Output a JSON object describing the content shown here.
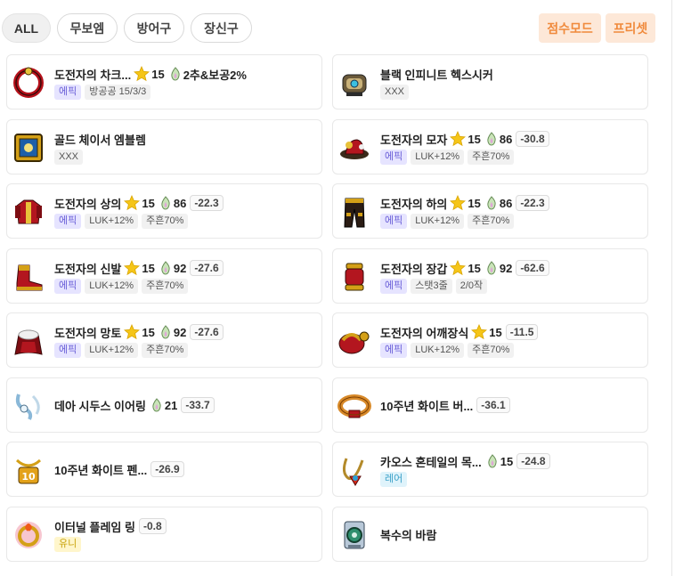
{
  "tabs": [
    {
      "label": "ALL",
      "active": true
    },
    {
      "label": "무보엠",
      "active": false
    },
    {
      "label": "방어구",
      "active": false
    },
    {
      "label": "장신구",
      "active": false
    }
  ],
  "modes": {
    "score_mode": "점수모드",
    "preset": "프리셋"
  },
  "colors": {
    "accent_orange": "#f08a3c",
    "epic": "#6a5fd8",
    "rare": "#3aa0c8",
    "unique": "#c8a20a"
  },
  "items": [
    {
      "name": "도전자의 차크...",
      "icon": "ring-red-icon",
      "star": "15",
      "extra": "2추&보공2%",
      "tags": [
        {
          "text": "에픽",
          "kind": "epic"
        },
        {
          "text": "방공공 15/3/3",
          "kind": "plain"
        }
      ]
    },
    {
      "name": "블랙 인피니트 헥스시커",
      "icon": "hexseeker-icon",
      "tags": [
        {
          "text": "XXX",
          "kind": "plain"
        }
      ]
    },
    {
      "name": "골드 체이서 엠블렘",
      "icon": "emblem-gold-icon",
      "tags": [
        {
          "text": "XXX",
          "kind": "plain"
        }
      ]
    },
    {
      "name": "도전자의 모자",
      "icon": "hat-icon",
      "star": "15",
      "flame": "86",
      "score": "-30.8",
      "tags": [
        {
          "text": "에픽",
          "kind": "epic"
        },
        {
          "text": "LUK+12%",
          "kind": "plain"
        },
        {
          "text": "주흔70%",
          "kind": "plain"
        }
      ]
    },
    {
      "name": "도전자의 상의",
      "icon": "top-icon",
      "star": "15",
      "flame": "86",
      "score": "-22.3",
      "tags": [
        {
          "text": "에픽",
          "kind": "epic"
        },
        {
          "text": "LUK+12%",
          "kind": "plain"
        },
        {
          "text": "주흔70%",
          "kind": "plain"
        }
      ]
    },
    {
      "name": "도전자의 하의",
      "icon": "bottom-icon",
      "star": "15",
      "flame": "86",
      "score": "-22.3",
      "tags": [
        {
          "text": "에픽",
          "kind": "epic"
        },
        {
          "text": "LUK+12%",
          "kind": "plain"
        },
        {
          "text": "주흔70%",
          "kind": "plain"
        }
      ]
    },
    {
      "name": "도전자의 신발",
      "icon": "shoes-icon",
      "star": "15",
      "flame": "92",
      "score": "-27.6",
      "tags": [
        {
          "text": "에픽",
          "kind": "epic"
        },
        {
          "text": "LUK+12%",
          "kind": "plain"
        },
        {
          "text": "주흔70%",
          "kind": "plain"
        }
      ]
    },
    {
      "name": "도전자의 장갑",
      "icon": "gloves-icon",
      "star": "15",
      "flame": "92",
      "score": "-62.6",
      "tags": [
        {
          "text": "에픽",
          "kind": "epic"
        },
        {
          "text": "스탯3줄",
          "kind": "plain"
        },
        {
          "text": "2/0작",
          "kind": "plain"
        }
      ]
    },
    {
      "name": "도전자의 망토",
      "icon": "cape-icon",
      "star": "15",
      "flame": "92",
      "score": "-27.6",
      "tags": [
        {
          "text": "에픽",
          "kind": "epic"
        },
        {
          "text": "LUK+12%",
          "kind": "plain"
        },
        {
          "text": "주흔70%",
          "kind": "plain"
        }
      ]
    },
    {
      "name": "도전자의 어깨장식",
      "icon": "shoulder-icon",
      "star": "15",
      "score": "-11.5",
      "tags": [
        {
          "text": "에픽",
          "kind": "epic"
        },
        {
          "text": "LUK+12%",
          "kind": "plain"
        },
        {
          "text": "주흔70%",
          "kind": "plain"
        }
      ]
    },
    {
      "name": "데아 시두스 이어링",
      "icon": "earring-icon",
      "flame": "21",
      "score": "-33.7",
      "tags": []
    },
    {
      "name": "10주년 화이트 버...",
      "icon": "belt-icon",
      "score": "-36.1",
      "tags": []
    },
    {
      "name": "10주년 화이트 펜...",
      "icon": "pendant-icon",
      "score": "-26.9",
      "tags": []
    },
    {
      "name": "카오스 혼테일의 목...",
      "icon": "necklace-icon",
      "flame": "15",
      "score": "-24.8",
      "tags": [
        {
          "text": "레어",
          "kind": "rare"
        }
      ]
    },
    {
      "name": "이터널 플레임 링",
      "icon": "ring-flame-icon",
      "score": "-0.8",
      "tags": [
        {
          "text": "유니",
          "kind": "unique"
        }
      ]
    },
    {
      "name": "복수의 바람",
      "icon": "badge-icon",
      "tags": []
    }
  ]
}
